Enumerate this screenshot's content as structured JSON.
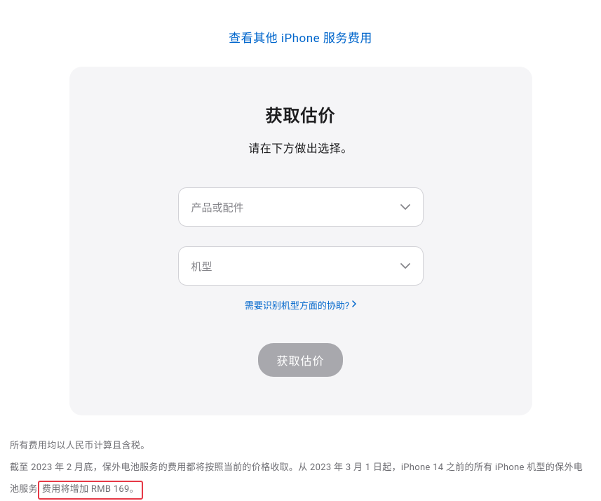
{
  "topLink": {
    "text": "查看其他 iPhone 服务费用"
  },
  "card": {
    "title": "获取估价",
    "subtitle": "请在下方做出选择。",
    "select1": {
      "placeholder": "产品或配件"
    },
    "select2": {
      "placeholder": "机型"
    },
    "helpLink": {
      "text": "需要识别机型方面的协助?"
    },
    "button": {
      "label": "获取估价"
    }
  },
  "footer": {
    "line1": "所有费用均以人民币计算且含税。",
    "line2_pre": "截至 2023 年 2 月底，保外电池服务的费用都将按照当前的价格收取。从 2023 年 3 月 1 日起，iPhone 14 之前的所有 iPhone 机型的保外电池服务",
    "line2_highlight": "费用将增加 RMB 169。"
  }
}
